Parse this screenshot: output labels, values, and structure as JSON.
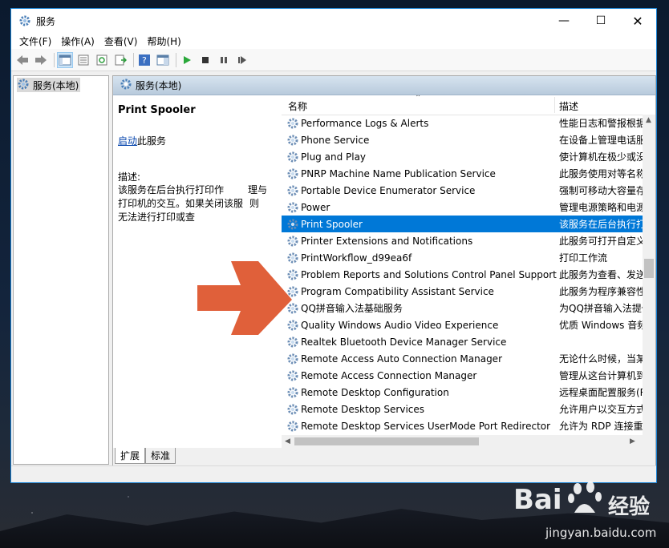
{
  "window": {
    "title": "服务"
  },
  "menu": [
    "文件(F)",
    "操作(A)",
    "查看(V)",
    "帮助(H)"
  ],
  "tree": {
    "root_label": "服务(本地)"
  },
  "panel": {
    "header": "服务(本地)"
  },
  "detail": {
    "service_name": "Print Spooler",
    "start_link": "启动",
    "start_suffix": "此服务",
    "desc_label": "描述:",
    "desc_line1": "该服务在后台执行打印作",
    "desc_line1b": "理与",
    "desc_line2": "打印机的交互。如果关闭该服",
    "desc_line2b": "则",
    "desc_line3": "无法进行打印或查"
  },
  "columns": {
    "name": "名称",
    "desc": "描述"
  },
  "rows": [
    {
      "name": "Performance Logs & Alerts",
      "desc": "性能日志和警报根据"
    },
    {
      "name": "Phone Service",
      "desc": "在设备上管理电话服"
    },
    {
      "name": "Plug and Play",
      "desc": "使计算机在极少或没"
    },
    {
      "name": "PNRP Machine Name Publication Service",
      "desc": "此服务使用对等名称"
    },
    {
      "name": "Portable Device Enumerator Service",
      "desc": "强制可移动大容量存"
    },
    {
      "name": "Power",
      "desc": "管理电源策略和电源"
    },
    {
      "name": "Print Spooler",
      "desc": "该服务在后台执行打"
    },
    {
      "name": "Printer Extensions and Notifications",
      "desc": "此服务可打开自定义"
    },
    {
      "name": "PrintWorkflow_d99ea6f",
      "desc": "打印工作流"
    },
    {
      "name": "Problem Reports and Solutions Control Panel Support",
      "desc": "此服务为查看、发送"
    },
    {
      "name": "Program Compatibility Assistant Service",
      "desc": "此服务为程序兼容性"
    },
    {
      "name": "QQ拼音输入法基础服务",
      "desc": "为QQ拼音输入法提供"
    },
    {
      "name": "Quality Windows Audio Video Experience",
      "desc": "优质 Windows 音频视"
    },
    {
      "name": "Realtek Bluetooth Device Manager Service",
      "desc": ""
    },
    {
      "name": "Remote Access Auto Connection Manager",
      "desc": "无论什么时候，当某"
    },
    {
      "name": "Remote Access Connection Manager",
      "desc": "管理从这台计算机到"
    },
    {
      "name": "Remote Desktop Configuration",
      "desc": "远程桌面配置服务(R"
    },
    {
      "name": "Remote Desktop Services",
      "desc": "允许用户以交互方式"
    },
    {
      "name": "Remote Desktop Services UserMode Port Redirector",
      "desc": "允许为 RDP 连接重定"
    }
  ],
  "selected_index": 6,
  "tabs": [
    "扩展",
    "标准"
  ],
  "watermark": {
    "brand": "Bai",
    "brand_suffix": "经验",
    "url": "jingyan.baidu.com"
  },
  "colors": {
    "selection": "#0078d7",
    "arrow": "#e0603a",
    "link": "#0645ad"
  }
}
